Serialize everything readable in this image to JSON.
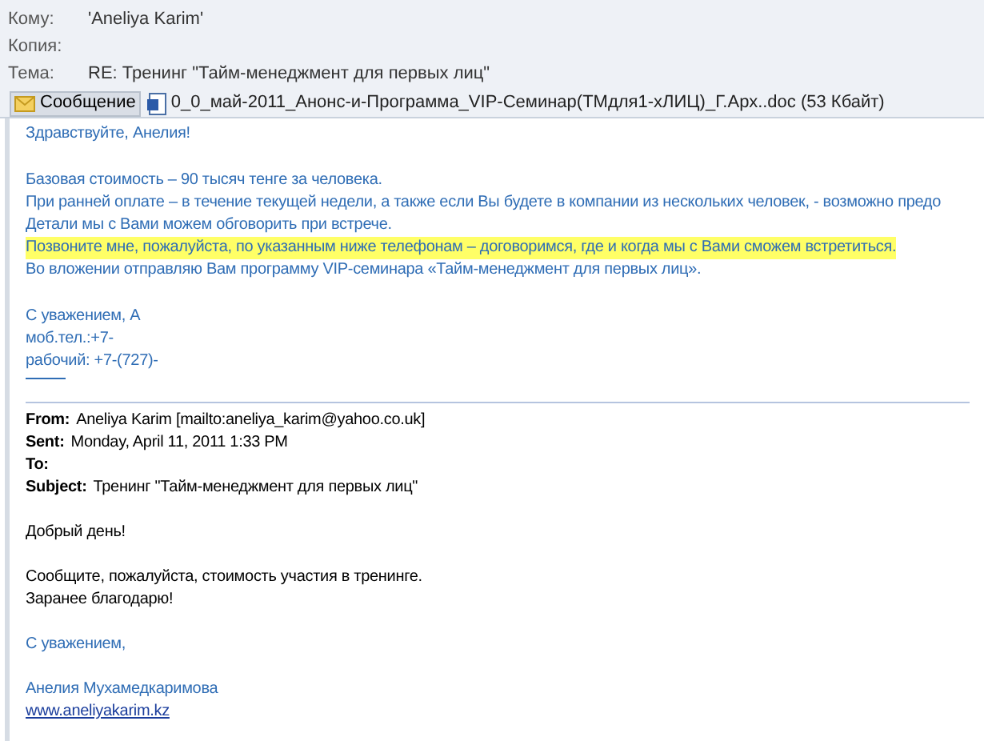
{
  "header": {
    "fields": [
      {
        "label": "Кому:",
        "value": "'Aneliya Karim'"
      },
      {
        "label": "Копия:"
      },
      {
        "label": "Тема:",
        "value": "RE: Тренинг \"Тайм-менеджмент для первых лиц\""
      }
    ]
  },
  "attachments": [
    {
      "kind": "message",
      "label": "Сообщение",
      "selected": true
    },
    {
      "kind": "document",
      "label": "0_0_май-2011_Анонс-и-Программа_VIP-Семинар(ТМдля1-хЛИЦ)_Г.Арх..doc (53 Кбайт)",
      "selected": false
    }
  ],
  "reply": {
    "paragraphs": [
      [
        "Здравствуйте, Анелия!"
      ],
      [
        "Базовая стоимость – 90 тысяч тенге за человека.",
        "При ранней оплате – в течение текущей недели, а также если Вы будете в компании из нескольких человек, - возможно предо",
        "Детали мы с Вами можем обговорить при встрече."
      ]
    ],
    "highlighted": "Позвоните мне, пожалуйста, по указанным ниже телефонам – договоримся, где и когда мы с Вами сможем встретиться.",
    "after_highlight": "Во вложении отправляю Вам программу VIP-семинара «Тайм-менеджмент для первых лиц».",
    "signature": [
      "С уважением, А",
      "моб.тел.:+7-",
      "рабочий: +7-(727)-"
    ]
  },
  "original": {
    "headers": [
      {
        "label": "From:",
        "value": "Aneliya Karim [mailto:aneliya_karim@yahoo.co.uk]"
      },
      {
        "label": "Sent:",
        "value": "Monday, April 11, 2011 1:33 PM"
      },
      {
        "label": "To:"
      },
      {
        "label": "Subject:",
        "value": "Тренинг \"Тайм-менеджмент для первых лиц\""
      }
    ],
    "body": [
      [
        "Добрый день!"
      ],
      [
        "Сообщите, пожалуйста, стоимость участия в тренинге.",
        "Заранее благодарю!"
      ]
    ],
    "closing": "С уважением,",
    "name": "Анелия Мухамедкаримова",
    "link": "www.aneliyakarim.kz"
  }
}
